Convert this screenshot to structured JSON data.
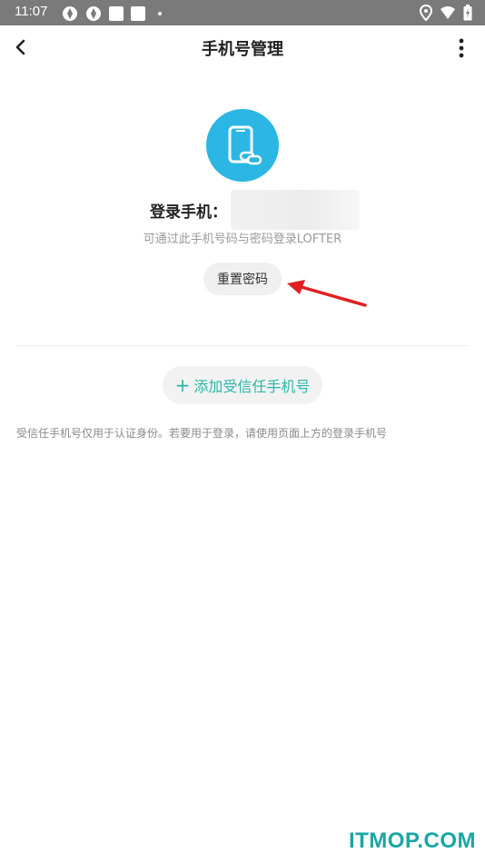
{
  "status_bar": {
    "time": "11:07",
    "icons": [
      "app-icon",
      "app-icon",
      "notification-icon",
      "notification-icon",
      "dot-icon",
      "location-icon",
      "wifi-icon",
      "battery-icon"
    ]
  },
  "header": {
    "title": "手机号管理",
    "back_icon": "chevron-left-icon",
    "more_icon": "more-vertical-icon"
  },
  "login_phone": {
    "icon": "phone-link-icon",
    "label": "登录手机：",
    "hint": "可通过此手机号码与密码登录LOFTER",
    "reset_password_label": "重置密码",
    "accent_color": "#2bb6e3"
  },
  "trusted_phone": {
    "add_label": "添加受信任手机号",
    "add_icon": "+",
    "note": "受信任手机号仅用于认证身份。若要用于登录，请使用页面上方的登录手机号",
    "accent_color": "#2ab7a7"
  },
  "watermark": "ITMOP.COM",
  "annotation_color": "#e02020"
}
